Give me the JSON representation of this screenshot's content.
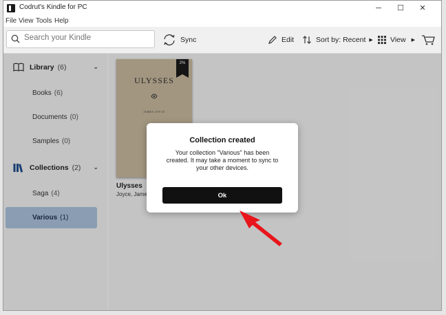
{
  "window": {
    "title": "Codrut's Kindle for PC",
    "controls": {
      "minimize": "─",
      "maximize": "☐",
      "close": "✕"
    }
  },
  "menu": {
    "items": [
      "File",
      "View",
      "Tools",
      "Help"
    ]
  },
  "toolbar": {
    "search_placeholder": "Search your Kindle",
    "sync_label": "Sync",
    "edit_label": "Edit",
    "sort_label": "Sort by: Recent",
    "view_label": "View"
  },
  "sidebar": {
    "library": {
      "label": "Library",
      "count": "(6)"
    },
    "library_items": [
      {
        "label": "Books",
        "count": "(6)"
      },
      {
        "label": "Documents",
        "count": "(0)"
      },
      {
        "label": "Samples",
        "count": "(0)"
      }
    ],
    "collections": {
      "label": "Collections",
      "count": "(2)"
    },
    "collection_items": [
      {
        "label": "Saga",
        "count": "(4)"
      },
      {
        "label": "Various",
        "count": "(1)",
        "selected": true
      }
    ]
  },
  "book": {
    "cover_title": "ULYSSES",
    "cover_author": "JAMES JOYCE",
    "progress": "2%",
    "title": "Ulysses",
    "author": "Joyce, James"
  },
  "dialog": {
    "title": "Collection created",
    "message": "Your collection \"Various\" has been created. It may take a moment to sync to your other devices.",
    "ok_label": "Ok"
  },
  "colors": {
    "accent": "#1f4e8c",
    "selected_bg": "#a9c0da",
    "arrow": "#e8151b"
  }
}
